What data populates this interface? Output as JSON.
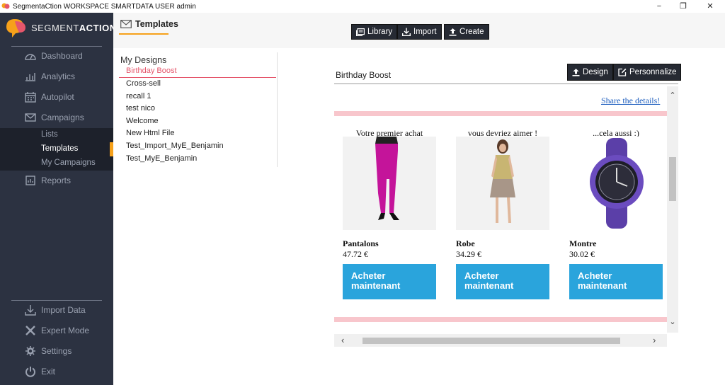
{
  "window": {
    "title": "SegmentaCtion WORKSPACE SMARTDATA USER admin",
    "minimize": "−",
    "maximize": "❐",
    "close": "✕"
  },
  "logo": {
    "prefix": "SEGMENT",
    "suffix": "ACTION"
  },
  "sidebar": {
    "items": [
      {
        "label": "Dashboard",
        "icon": "dashboard-icon"
      },
      {
        "label": "Analytics",
        "icon": "bar-chart-icon"
      },
      {
        "label": "Autopilot",
        "icon": "calendar-icon"
      },
      {
        "label": "Campaigns",
        "icon": "envelope-icon"
      }
    ],
    "subitems": [
      {
        "label": "Lists"
      },
      {
        "label": "Templates"
      },
      {
        "label": "My Campaigns"
      }
    ],
    "reports": {
      "label": "Reports",
      "icon": "report-icon"
    },
    "bottom": [
      {
        "label": "Import Data",
        "icon": "download-icon"
      },
      {
        "label": "Expert Mode",
        "icon": "tools-icon"
      },
      {
        "label": "Settings",
        "icon": "gear-icon"
      },
      {
        "label": "Exit",
        "icon": "power-icon"
      }
    ]
  },
  "header": {
    "tab": "Templates",
    "buttons": {
      "library": "Library",
      "import": "Import",
      "create": "Create"
    }
  },
  "designs": {
    "title": "My Designs",
    "items": [
      "Birthday Boost",
      "Cross-sell",
      "recall 1",
      "test nico",
      "Welcome",
      "New Html File",
      "Test_Import_MyE_Benjamin",
      "Test_MyE_Benjamin"
    ],
    "selected": "Birthday Boost"
  },
  "preview": {
    "title": "Birthday Boost",
    "design_btn": "Design",
    "personalize_btn": "Personnalize",
    "share_link": "Share the details!",
    "products": [
      {
        "caption": "Votre premier achat",
        "name": "Pantalons",
        "price": "47.72 €",
        "button": "Acheter maintenant"
      },
      {
        "caption": "vous devriez aimer !",
        "name": "Robe",
        "price": "34.29 €",
        "button": "Acheter maintenant"
      },
      {
        "caption": "...cela aussi :)",
        "name": "Montre",
        "price": "30.02 €",
        "button": "Acheter maintenant"
      }
    ]
  },
  "colors": {
    "sidebar_bg": "#2c3241",
    "accent": "#f6a11a",
    "selected_text": "#e5566b",
    "buy_button": "#2aa4dc",
    "pink_bar": "#f8c6cc"
  }
}
